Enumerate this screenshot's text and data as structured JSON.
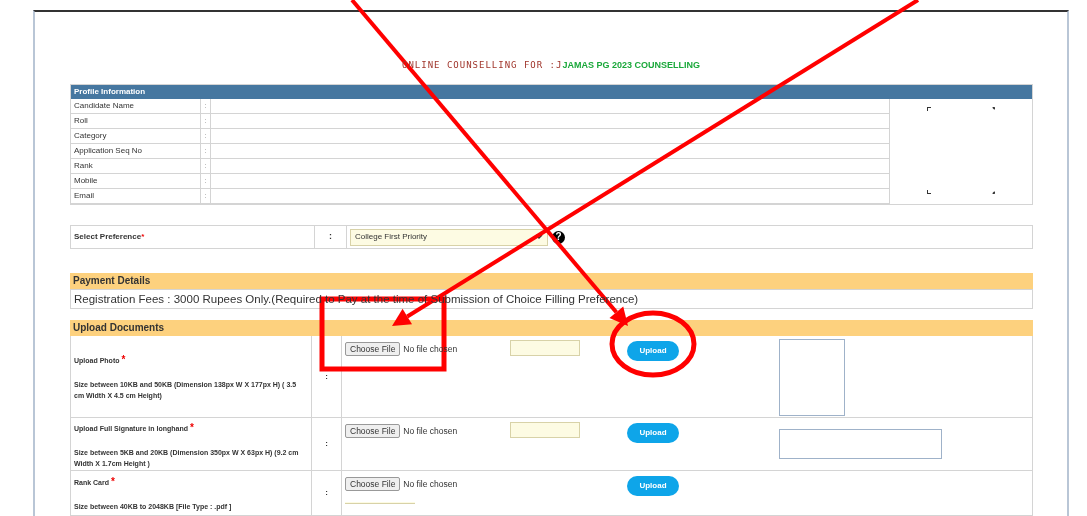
{
  "title": {
    "prefix": "ONLINE COUNSELLING FOR :J",
    "name": "JAMAS PG 2023 COUNSELLING"
  },
  "profile": {
    "heading": "Profile Information",
    "rows": [
      {
        "label": "Candidate Name",
        "separator": ":"
      },
      {
        "label": "Roll",
        "separator": ":"
      },
      {
        "label": "Category",
        "separator": ":"
      },
      {
        "label": "Application Seq No",
        "separator": ":"
      },
      {
        "label": "Rank",
        "separator": ":"
      },
      {
        "label": "Mobile",
        "separator": ":"
      },
      {
        "label": "Email",
        "separator": ":"
      }
    ]
  },
  "preference": {
    "label": "Select Preference",
    "required_mark": "*",
    "separator": ":",
    "value": "College First Priority",
    "help_icon": "?"
  },
  "payment": {
    "heading": "Payment Details",
    "text": "Registration Fees : 3000 Rupees Only.(Required to Pay at the time of Submission of Choice Filling Preference)"
  },
  "upload": {
    "heading": "Upload Documents",
    "rows": [
      {
        "label": "Upload Photo",
        "required_mark": "*",
        "hint": "Size between 10KB and 50KB (Dimension 138px W X 177px H) ( 3.5 cm Width X 4.5 cm Height)",
        "separator": ":",
        "choose": "Choose File",
        "file_status": "No file chosen",
        "button": "Upload",
        "kind": "photo"
      },
      {
        "label": "Upload Full Signature in longhand",
        "required_mark": "*",
        "hint": "Size between 5KB and 20KB (Dimension 350px W X 63px H) (9.2 cm Width X 1.7cm Height )",
        "separator": ":",
        "choose": "Choose File",
        "file_status": "No file chosen",
        "button": "Upload",
        "kind": "signature"
      },
      {
        "label": "Rank Card",
        "required_mark": "*",
        "hint": "Size between 40KB to 2048KB [File Type : .pdf ]",
        "separator": ":",
        "choose": "Choose File",
        "file_status": "No file chosen",
        "button": "Upload",
        "kind": "document"
      }
    ]
  },
  "annotations": [
    {
      "kind": "arrow"
    },
    {
      "kind": "arrow"
    },
    {
      "kind": "rectangle"
    },
    {
      "kind": "ellipse"
    }
  ]
}
